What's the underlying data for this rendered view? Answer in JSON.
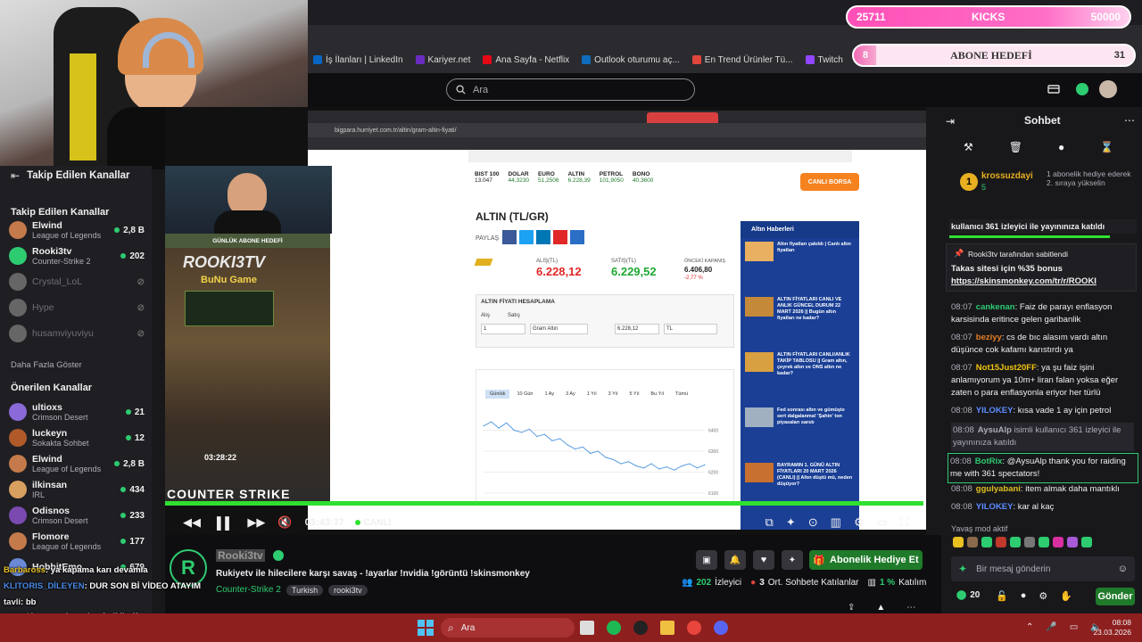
{
  "overlay": {
    "kicks": {
      "count": "25711",
      "label": "KICKS",
      "goal": "50000"
    },
    "subs": {
      "count": "8",
      "label": "ABONE HEDEFİ",
      "goal": "31"
    }
  },
  "bookmarks": [
    {
      "label": "İş İlanları | LinkedIn",
      "color": "#0a66c2"
    },
    {
      "label": "Kariyer.net",
      "color": "#6a2cc1"
    },
    {
      "label": "Ana Sayfa - Netflix",
      "color": "#e50914"
    },
    {
      "label": "Outlook oturumu aç...",
      "color": "#0f6cbd"
    },
    {
      "label": "En Trend Ürünler Tü...",
      "color": "#e0453b"
    },
    {
      "label": "Twitch",
      "color": "#9146ff"
    },
    {
      "label": "Nightbot - Giveaways",
      "color": "#5a5a5a"
    },
    {
      "label": "Tüm Yer İşareti",
      "color": "#777777"
    }
  ],
  "search": {
    "placeholder": "Ara"
  },
  "sidebar": {
    "followed_title_top": "Takip Edilen Kanallar",
    "followed_title": "Takip Edilen Kanallar",
    "followed": [
      {
        "name": "Elwind",
        "game": "League of Legends",
        "viewers": "2,8 B",
        "live": true
      },
      {
        "name": "Rooki3tv",
        "game": "Counter-Strike 2",
        "viewers": "202",
        "live": true
      },
      {
        "name": "Crystal_LoL",
        "game": "",
        "viewers": "",
        "live": false
      },
      {
        "name": "Hype",
        "game": "",
        "viewers": "",
        "live": false
      },
      {
        "name": "husamviyuviyu",
        "game": "",
        "viewers": "",
        "live": false
      }
    ],
    "show_more": "Daha Fazla Göster",
    "recommended_title": "Önerilen Kanallar",
    "recommended": [
      {
        "name": "ultioxs",
        "game": "Crimson Desert",
        "viewers": "21"
      },
      {
        "name": "luckeyn",
        "game": "Sokakta Sohbet",
        "viewers": "12"
      },
      {
        "name": "Elwind",
        "game": "League of Legends",
        "viewers": "2,8 B"
      },
      {
        "name": "ilkinsan",
        "game": "IRL",
        "viewers": "434"
      },
      {
        "name": "Odisnos",
        "game": "Crimson Desert",
        "viewers": "233"
      },
      {
        "name": "Flomore",
        "game": "League of Legends",
        "viewers": "177"
      },
      {
        "name": "HobbitEmo",
        "game": "",
        "viewers": "679"
      }
    ]
  },
  "inner_page": {
    "url": "bigpara.hurriyet.com.tr/altin/gram-altin-fiyati/",
    "title": "ALTIN (TL/GR)",
    "share": "PAYLAŞ",
    "buy_label": "ALIŞ(TL)",
    "buy": "6.228,12",
    "sell_label": "SATIŞ(TL)",
    "sell": "6.229,52",
    "close_label": "ÖNCEKİ KAPANIŞ",
    "close": "6.406,80",
    "change": "-2,77 %",
    "calc_title": "ALTIN FİYATI HESAPLAMA",
    "calc_buy": "Alış",
    "calc_sell": "Satış",
    "calc_qty": "1",
    "calc_unit": "Gram Altın",
    "calc_result": "6.228,12",
    "calc_cur": "TL",
    "live_btn": "CANLI BORSA",
    "news_title": "Altın Haberleri",
    "news": [
      "Altın fiyatları çakıldı | Canlı altın fiyatları",
      "ALTIN FİYATLARI CANLI VE ANLIK GÜNCEL DURUM 22 MART 2026 || Bugün altın fiyatları ne kadar?",
      "ALTIN FİYATLARI CANLI/ANLIK TAKİP TABLOSU || Gram altın, çeyrek altın ve ONS altın ne kadar?",
      "Fed sonrası altın ve gümüşte sert dalgalanma! 'Şahin' ton piyasaları sarstı",
      "BAYRAMIN 1. GÜNÜ ALTIN FİYATLARI 20 MART 2026 (CANLI) || Altın düştü mü, neden düşüyor?"
    ],
    "ranges": [
      "Günlük",
      "10 Gün",
      "1 Ay",
      "3 Ay",
      "1 Yıl",
      "3 Yıl",
      "5 Yıl",
      "Bu Yıl",
      "Tümü"
    ],
    "ticker": [
      {
        "n": "BIST 100",
        "v": "13.047"
      },
      {
        "n": "DOLAR",
        "v": "44,3230"
      },
      {
        "n": "EURO",
        "v": "51,2506"
      },
      {
        "n": "ALTIN",
        "v": "6.228,39"
      },
      {
        "n": "PETROL",
        "v": "101,9050"
      },
      {
        "n": "BONO",
        "v": "40,3600"
      }
    ]
  },
  "chart_data": {
    "type": "line",
    "series": [
      {
        "values": [
          6420,
          6440,
          6410,
          6435,
          6400,
          6390,
          6405,
          6370,
          6380,
          6350,
          6360,
          6330,
          6310,
          6320,
          6290,
          6300,
          6270,
          6260,
          6240,
          6250,
          6230,
          6220,
          6240,
          6215,
          6225,
          6210,
          6230,
          6240,
          6220,
          6235
        ]
      }
    ],
    "ylim": [
      6100,
      6500
    ],
    "yticks": [
      "6400",
      "6300",
      "6200",
      "6100"
    ]
  },
  "cs_overlay": {
    "title": "GÜNLÜK ABONE HEDEFİ",
    "brand": "ROOKI3TV",
    "sub": "BuNu Game",
    "time": "03:28:22",
    "game": "COUNTER STRIKE"
  },
  "player": {
    "time": "03:43:37",
    "live": "CANLI"
  },
  "stream": {
    "channel": "Rooki3tv",
    "title": "Rukiyetv ile hilecilere karşı savaş -  !ayarlar !nvidia !görüntü !skinsmonkey",
    "game": "Counter-Strike 2",
    "tags": [
      "Turkish",
      "rooki3tv"
    ],
    "gift_btn": "Abonelik Hediye Et",
    "viewers": "202",
    "viewers_label": "İzleyici",
    "avg": "3",
    "avg_label": "Ort. Sohbete Katılanlar",
    "pct": "1 %",
    "pct_label": "Katılım"
  },
  "chat": {
    "title": "Sohbet",
    "top_user": "krossuzdayi",
    "top_user_count": "5",
    "gift_info": "1 abonelik hediye ederek 2. sıraya yükselin",
    "raid_banner": "kullanıcı 361 izleyici ile yayınınıza katıldı",
    "pinned_by": "Rooki3tv tarafından sabitlendi",
    "pinned_text": "Takas sitesi için %35 bonus",
    "pinned_link": "https://skinsmonkey.com/tr/r/ROOKI",
    "messages": [
      {
        "t": "08:07",
        "u": "cankenan",
        "c": "#2ecc71",
        "m": "Faiz de parayı enflasyon karsisinda eritince gelen garibanlik"
      },
      {
        "t": "08:07",
        "u": "beziyy",
        "c": "#e67e22",
        "m": "cs de bıc alasım vardı altın düşünce cok kafamı karıstırdı ya"
      },
      {
        "t": "08:07",
        "u": "Not15Just20FF",
        "c": "#f1c40f",
        "m": "ya şu faiz işini anlamıyorum ya 10m+ liran falan yoksa eğer zaten o para enflasyonla eriyor her türlü"
      },
      {
        "t": "08:08",
        "u": "YILOKEY",
        "c": "#5b8cff",
        "m": "kısa vade 1 ay için petrol"
      },
      {
        "t": "08:08",
        "u": "AysuAlp",
        "c": "#adadb8",
        "m": "isimli kullanıcı 361 izleyici ile yayınınıza katıldı"
      },
      {
        "t": "08:08",
        "u": "BotRix",
        "c": "#2ecc71",
        "m": "@AysuAlp thank you for raiding me with 361 spectators!"
      },
      {
        "t": "08:08",
        "u": "ggulyabani",
        "c": "#e0c020",
        "m": "item almak daha mantıklı"
      },
      {
        "t": "08:08",
        "u": "YILOKEY",
        "c": "#5b8cff",
        "m": "kar al kaç"
      }
    ],
    "slow_mode": "Yavaş mod aktif",
    "input_placeholder": "Bir mesaj gönderin",
    "points": "20",
    "send": "Gönder"
  },
  "overlay_chat": [
    {
      "u": "Barbaross",
      "m": ": ya kapama karı devamla"
    },
    {
      "u": "KLITORIS_DİLEYEN",
      "m": ": DUR SON Bİ VİDEO ATAYIM"
    },
    {
      "u": "tavli",
      "m": ": bb"
    },
    {
      "u": "gurty48",
      "m": ": saçmalama lan fgdkjlgdf"
    },
    {
      "u": "Mllzer",
      "m": ""
    }
  ],
  "taskbar": {
    "search": "Ara",
    "time": "08:08",
    "date": "23.03.2026"
  }
}
